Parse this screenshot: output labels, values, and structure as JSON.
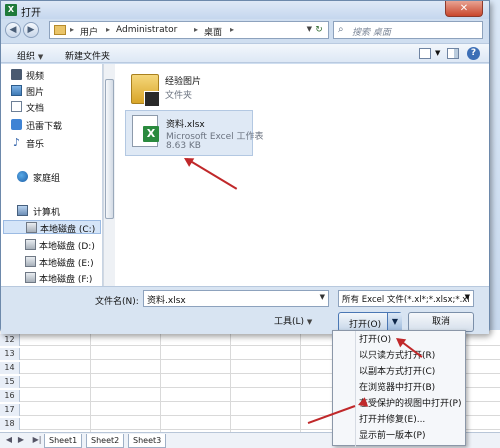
{
  "window": {
    "title": "打开",
    "close_label": "✕"
  },
  "address": {
    "segments": [
      "用户",
      "Administrator",
      "桌面"
    ],
    "search_placeholder": "搜索 桌面"
  },
  "toolbar": {
    "organize": "组织",
    "new_folder": "新建文件夹"
  },
  "nav": {
    "items": [
      {
        "label": "视频",
        "icon": "video-icon"
      },
      {
        "label": "图片",
        "icon": "picture-icon"
      },
      {
        "label": "文档",
        "icon": "document-icon"
      },
      {
        "label": "迅雷下载",
        "icon": "thunder-download-icon"
      },
      {
        "label": "音乐",
        "icon": "music-icon"
      },
      {
        "label": "家庭组",
        "icon": "homegroup-icon"
      },
      {
        "label": "计算机",
        "icon": "computer-icon"
      },
      {
        "label": "本地磁盘 (C:)",
        "icon": "disk-icon",
        "selected": true
      },
      {
        "label": "本地磁盘 (D:)",
        "icon": "disk-icon"
      },
      {
        "label": "本地磁盘 (E:)",
        "icon": "disk-icon"
      },
      {
        "label": "本地磁盘 (F:)",
        "icon": "disk-icon"
      }
    ]
  },
  "files": [
    {
      "name": "经验图片",
      "sub1": "文件夹",
      "type": "folder"
    },
    {
      "name": "资料.xlsx",
      "sub1": "Microsoft Excel 工作表",
      "sub2": "8.63 KB",
      "type": "xlsx"
    }
  ],
  "bottom": {
    "filename_label": "文件名(N):",
    "filename_value": "资料.xlsx",
    "filetype_value": "所有 Excel 文件(*.xl*;*.xlsx;*.xl",
    "tools_label": "工具(L)",
    "open_label": "打开(O)",
    "cancel_label": "取消"
  },
  "open_menu": [
    "打开(O)",
    "以只读方式打开(R)",
    "以副本方式打开(C)",
    "在浏览器中打开(B)",
    "在受保护的视图中打开(P)",
    "打开并修复(E)...",
    "显示前一版本(P)"
  ],
  "excel": {
    "rows": [
      "12",
      "13",
      "14",
      "15",
      "16",
      "17",
      "18"
    ],
    "sheets": [
      "Sheet1",
      "Sheet2",
      "Sheet3"
    ]
  },
  "colors": {
    "accent": "#4a77b4",
    "annotation_arrow": "#c0282a",
    "excel_green": "#1f7a3a"
  }
}
